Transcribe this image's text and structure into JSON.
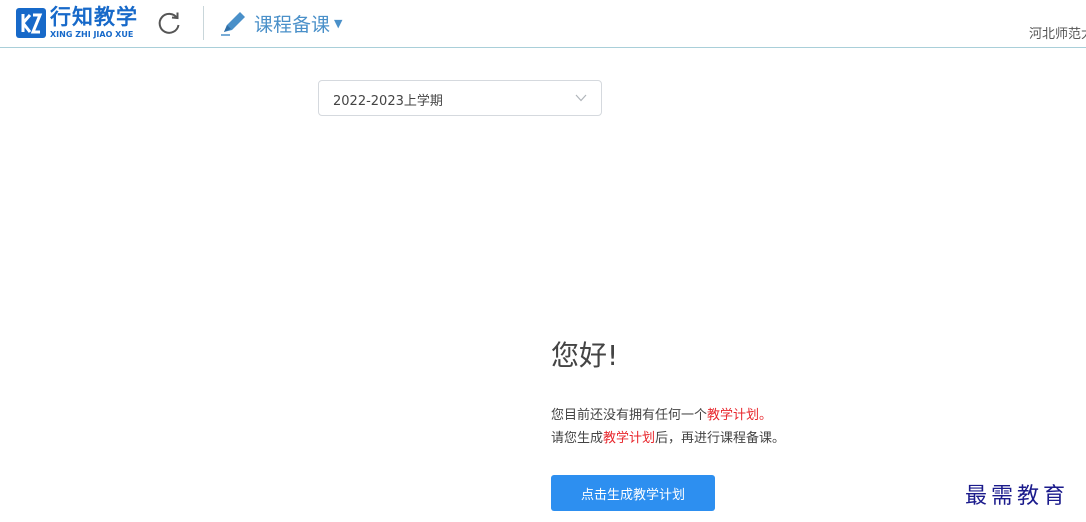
{
  "header": {
    "logo_cn": "行知教学",
    "logo_en": "XING ZHI JIAO XUE",
    "menu_label": "课程备课",
    "school_name": "河北师范大",
    "brand_color": "#1769c9",
    "accent_color": "#4a90c9"
  },
  "icons": {
    "logo": "logo-icon",
    "refresh": "refresh-icon",
    "pencil": "pencil-icon",
    "caret": "caret-down-icon",
    "select_chevron": "chevron-down-icon"
  },
  "term_select": {
    "value": "2022-2023上学期"
  },
  "empty_state": {
    "greeting": "您好!",
    "line1_prefix": "您目前还没有拥有任何一个",
    "line1_highlight": "教学计划。",
    "line2_prefix": "请您生成",
    "line2_highlight": "教学计划",
    "line2_suffix": "后，再进行课程备课。",
    "highlight_color": "#e8262c",
    "button_label": "点击生成教学计划",
    "button_color": "#2d8ff0"
  },
  "watermark": "最需教育"
}
